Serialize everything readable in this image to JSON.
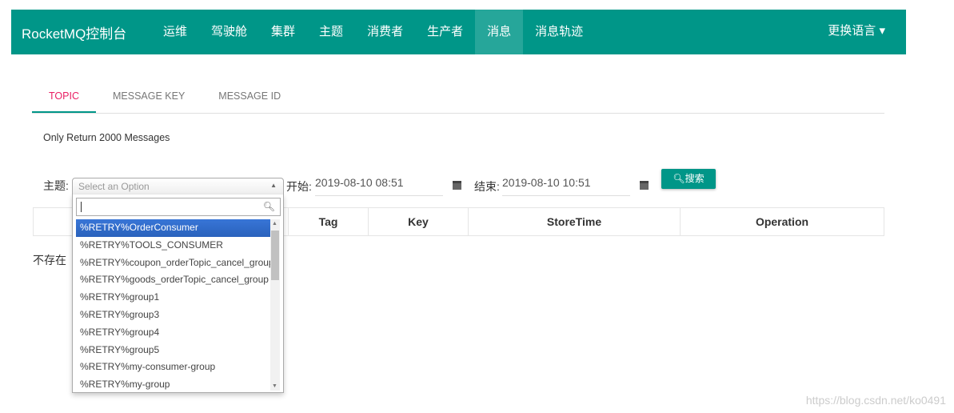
{
  "nav": {
    "brand": "RocketMQ控制台",
    "items": [
      "运维",
      "驾驶舱",
      "集群",
      "主题",
      "消费者",
      "生产者",
      "消息",
      "消息轨迹"
    ],
    "active": "消息",
    "lang": "更换语言 ▾"
  },
  "tabs": [
    "TOPIC",
    "MESSAGE KEY",
    "MESSAGE ID"
  ],
  "note": "Only Return 2000 Messages",
  "form": {
    "topic_label": "主题:",
    "topic_placeholder": "Select an Option",
    "start_label": "开始:",
    "start_value": "2019-08-10 08:51",
    "end_label": "结束:",
    "end_value": "2019-08-10 10:51",
    "search_button": "搜索"
  },
  "table": {
    "headers": [
      "",
      "Tag",
      "Key",
      "StoreTime",
      "Operation"
    ]
  },
  "empty": "不存在",
  "dropdown": {
    "options": [
      "%RETRY%OrderConsumer",
      "%RETRY%TOOLS_CONSUMER",
      "%RETRY%coupon_orderTopic_cancel_group",
      "%RETRY%goods_orderTopic_cancel_group",
      "%RETRY%group1",
      "%RETRY%group3",
      "%RETRY%group4",
      "%RETRY%group5",
      "%RETRY%my-consumer-group",
      "%RETRY%my-group"
    ],
    "highlighted": 0
  },
  "watermark": "https://blog.csdn.net/ko0491",
  "colors": {
    "primary": "#009688",
    "active_tab": "#e91e63",
    "highlight": "#3875d7"
  }
}
